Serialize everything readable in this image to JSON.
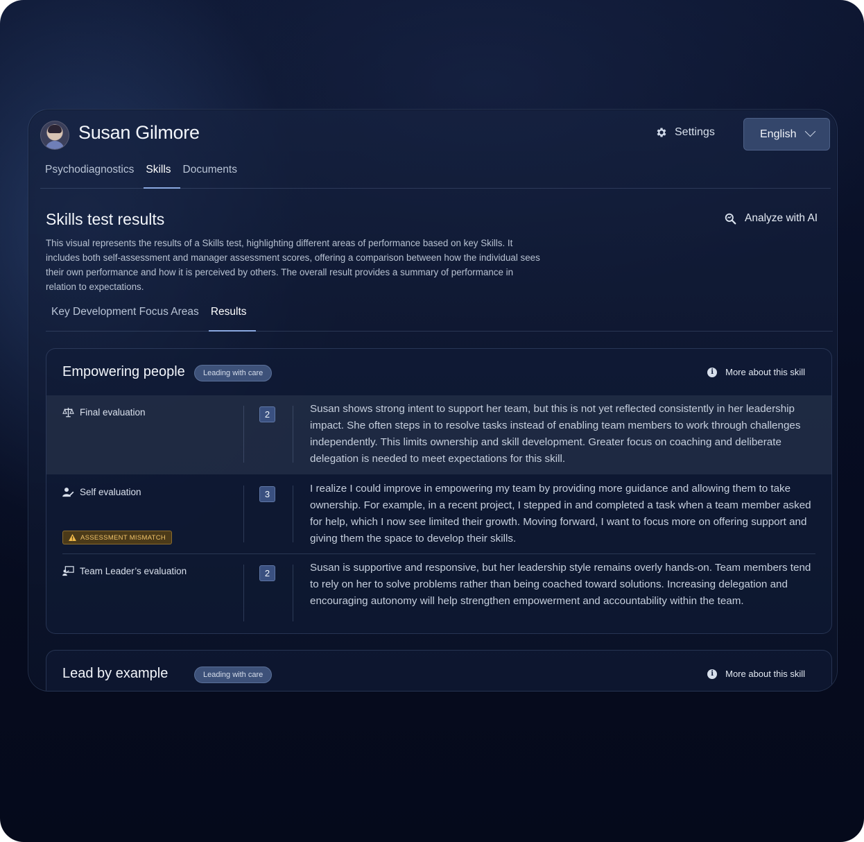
{
  "header": {
    "user_name": "Susan Gilmore",
    "settings_label": "Settings",
    "language": "English"
  },
  "top_tabs": [
    {
      "label": "Psychodiagnostics",
      "active": false
    },
    {
      "label": "Skills",
      "active": true
    },
    {
      "label": "Documents",
      "active": false
    }
  ],
  "section": {
    "title": "Skills test results",
    "analyze_label": "Analyze with AI",
    "description": "This visual represents the results of a Skills test, highlighting different areas of performance based on key Skills. It includes both self-assessment and manager assessment scores, offering a comparison between how the individual sees their own performance and how it is perceived by others. The overall result provides a summary of performance in relation to expectations."
  },
  "sub_tabs": [
    {
      "label": "Key Development Focus Areas",
      "active": false
    },
    {
      "label": "Results",
      "active": true
    }
  ],
  "skills": [
    {
      "title": "Empowering people",
      "tag": "Leading with care",
      "more_label": "More about this skill",
      "evaluations": [
        {
          "label": "Final evaluation",
          "icon": "scale-icon",
          "score": "2",
          "text": "Susan shows strong intent to support her team, but this is not yet reflected consistently in her leadership impact. She often steps in to resolve tasks instead of enabling team members to work through challenges independently. This limits ownership and skill development. Greater focus on coaching and deliberate delegation is needed to meet expectations for this skill."
        },
        {
          "label": "Self evaluation",
          "icon": "user-edit-icon",
          "score": "3",
          "badge": "ASSESSMENT MISMATCH",
          "text": "I realize I could improve in empowering my team by providing more guidance and allowing them to take ownership. For example, in a recent project, I stepped in and completed a task when a team member asked for help, which I now see limited their growth. Moving forward, I want to focus more on offering support and giving them the space to develop their skills."
        },
        {
          "label": "Team Leader’s evaluation",
          "icon": "presenter-icon",
          "score": "2",
          "text": "Susan is supportive and responsive, but her leadership style remains overly hands-on. Team members tend to rely on her to solve problems rather than being coached toward solutions. Increasing delegation and encouraging autonomy will help strengthen empowerment and accountability within the team."
        }
      ]
    },
    {
      "title": "Lead by example",
      "tag": "Leading with care",
      "more_label": "More about this skill"
    }
  ]
}
